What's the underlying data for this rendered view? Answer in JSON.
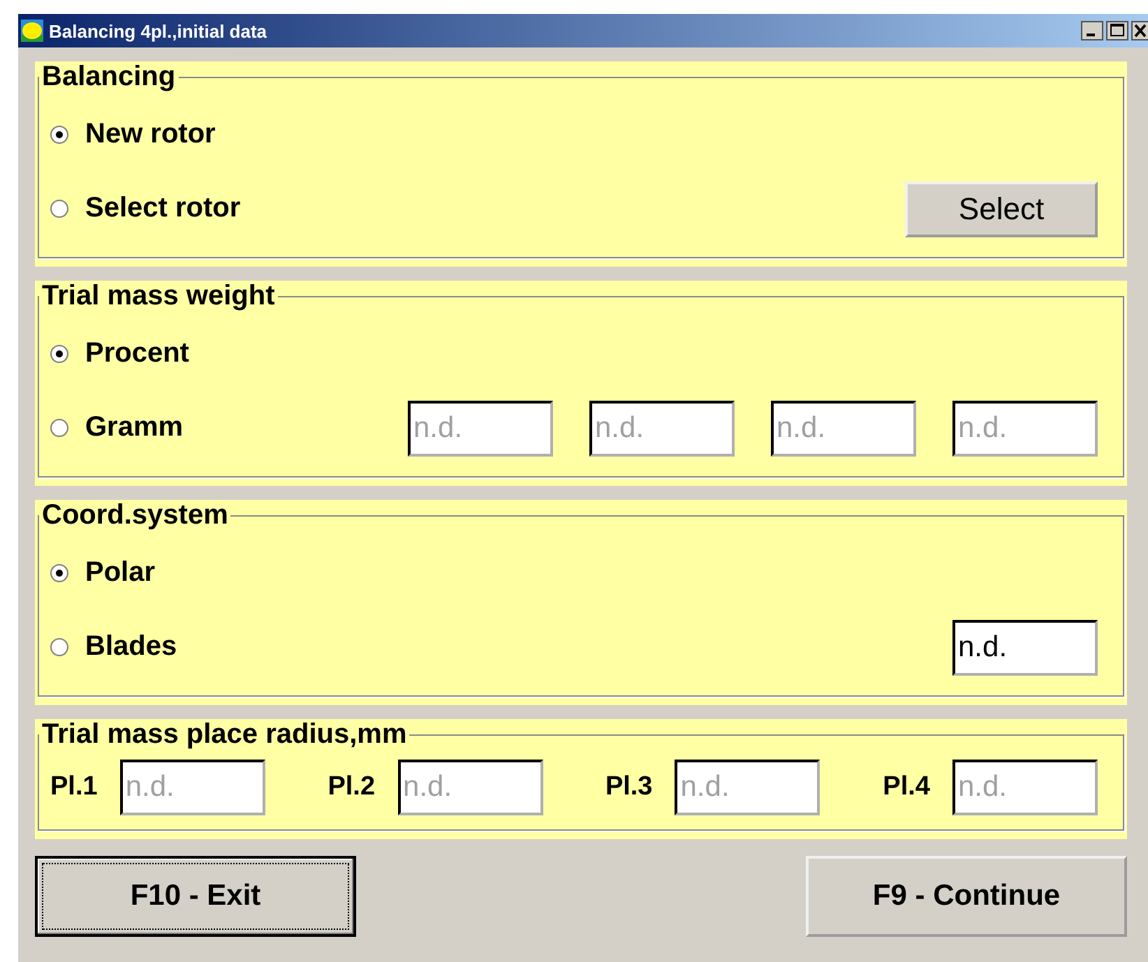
{
  "window": {
    "title": "Balancing 4pl.,initial data"
  },
  "groups": [
    {
      "title": "Balancing",
      "options": [
        {
          "label": "New rotor",
          "selected": true
        },
        {
          "label": "Select rotor",
          "selected": false
        }
      ],
      "button": "Select"
    },
    {
      "title": "Trial mass weight",
      "options": [
        {
          "label": "Procent",
          "selected": true
        },
        {
          "label": "Gramm",
          "selected": false
        }
      ],
      "fields": [
        {
          "value": "n.d.",
          "disabled": true
        },
        {
          "value": "n.d.",
          "disabled": true
        },
        {
          "value": "n.d.",
          "disabled": true
        },
        {
          "value": "n.d.",
          "disabled": true
        }
      ]
    },
    {
      "title": "Coord.system",
      "options": [
        {
          "label": "Polar",
          "selected": true
        },
        {
          "label": "Blades",
          "selected": false
        }
      ],
      "fields": [
        {
          "value": "n.d.",
          "disabled": false
        }
      ]
    }
  ],
  "radius": {
    "title": "Trial mass place radius,mm",
    "places": [
      {
        "label": "Pl.1",
        "value": "n.d.",
        "disabled": true
      },
      {
        "label": "Pl.2",
        "value": "n.d.",
        "disabled": true
      },
      {
        "label": "Pl.3",
        "value": "n.d.",
        "disabled": true
      },
      {
        "label": "Pl.4",
        "value": "n.d.",
        "disabled": true
      }
    ]
  },
  "buttons": [
    {
      "label": "F10 - Exit",
      "focused": true
    },
    {
      "label": "F9 - Continue",
      "focused": false
    }
  ]
}
